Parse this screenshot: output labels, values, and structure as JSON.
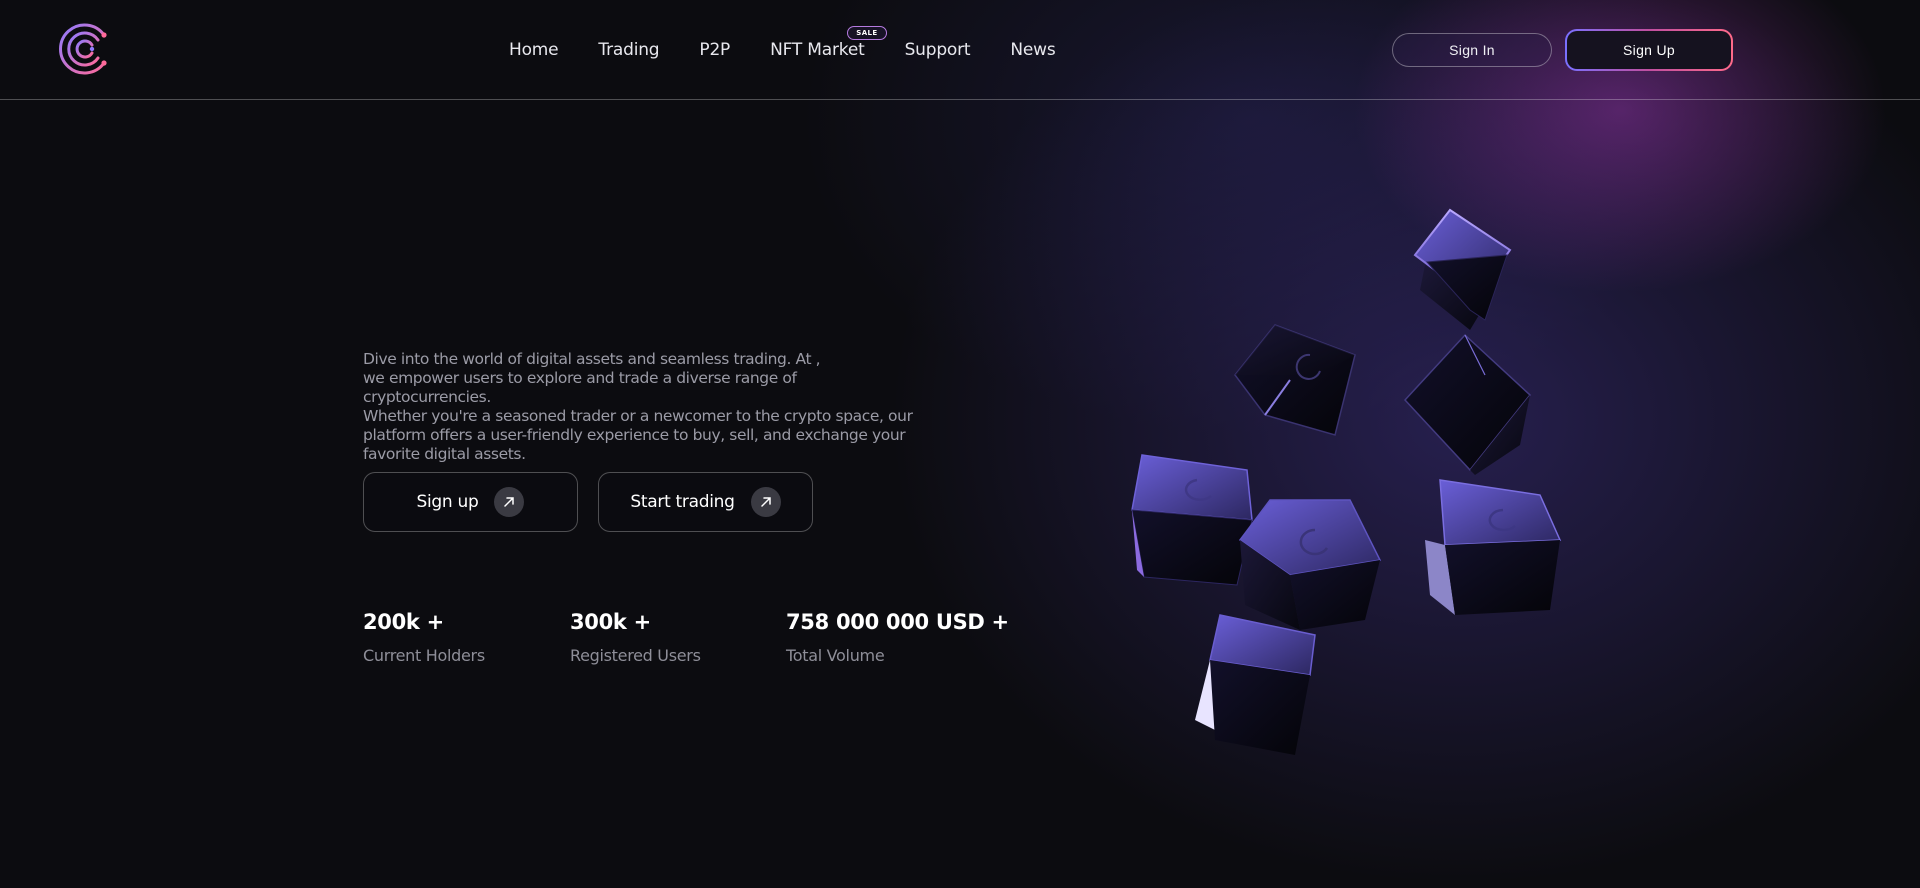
{
  "header": {
    "nav": [
      {
        "label": "Home"
      },
      {
        "label": "Trading"
      },
      {
        "label": "P2P"
      },
      {
        "label": "NFT Market",
        "badge": "SALE"
      },
      {
        "label": "Support"
      },
      {
        "label": "News"
      }
    ],
    "sign_in_label": "Sign In",
    "sign_up_label": "Sign Up"
  },
  "hero": {
    "description_lines": [
      "Dive into the world of digital assets and seamless trading. At ,",
      "we empower users to explore and trade a diverse range of cryptocurrencies.",
      "Whether you're a seasoned trader or a newcomer to the crypto space, our",
      "platform offers a user-friendly experience to buy, sell, and exchange your",
      "favorite digital assets."
    ],
    "buttons": [
      {
        "label": "Sign up",
        "icon": "arrow-up-right-icon"
      },
      {
        "label": "Start trading",
        "icon": "arrow-up-right-icon"
      }
    ],
    "stats": [
      {
        "value": "200k +",
        "label": "Current Holders"
      },
      {
        "value": "300k +",
        "label": "Registered Users"
      },
      {
        "value": "758 000 000 USD +",
        "label": "Total Volume"
      }
    ]
  },
  "colors": {
    "background": "#0c0c10",
    "accent_purple": "#7a70ff",
    "accent_pink": "#ff6a8a",
    "glow": "#8c32a0"
  }
}
